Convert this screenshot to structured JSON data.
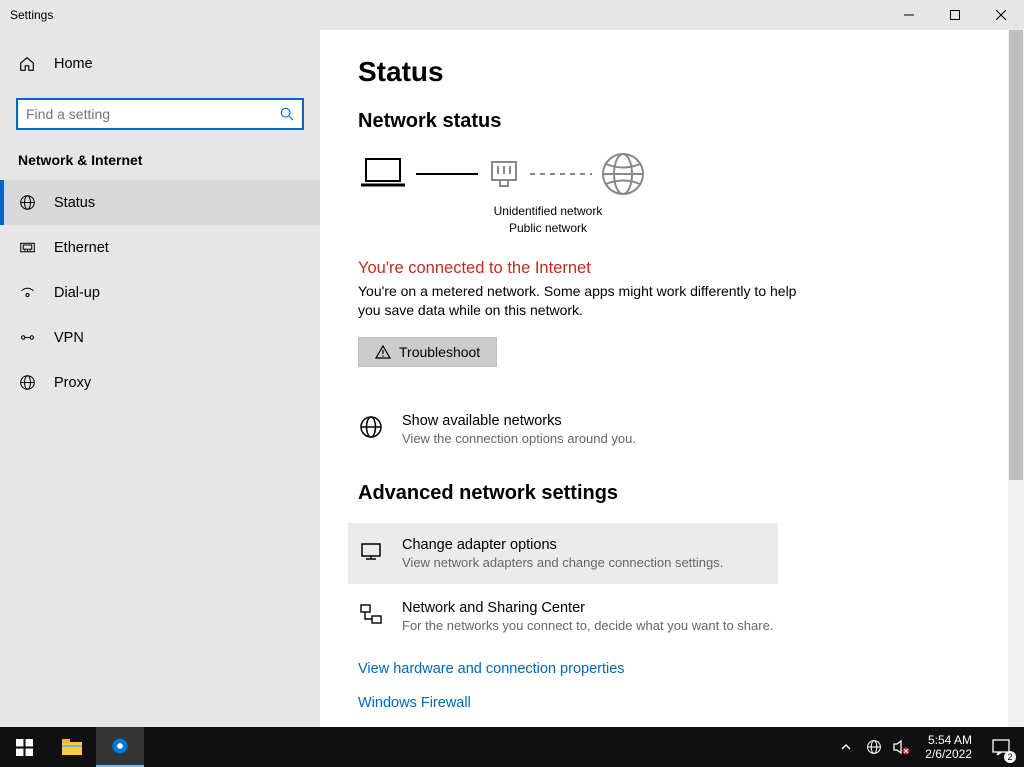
{
  "window": {
    "title": "Settings"
  },
  "sidebar": {
    "home": "Home",
    "search_placeholder": "Find a setting",
    "section": "Network & Internet",
    "items": [
      {
        "label": "Status",
        "icon": "globe-net-icon",
        "active": true
      },
      {
        "label": "Ethernet",
        "icon": "ethernet-icon",
        "active": false
      },
      {
        "label": "Dial-up",
        "icon": "dialup-icon",
        "active": false
      },
      {
        "label": "VPN",
        "icon": "vpn-icon",
        "active": false
      },
      {
        "label": "Proxy",
        "icon": "globe-icon",
        "active": false
      }
    ]
  },
  "main": {
    "title": "Status",
    "net_status_heading": "Network status",
    "diagram": {
      "label1": "Unidentified network",
      "label2": "Public network"
    },
    "status_title": "You're connected to the Internet",
    "status_desc": "You're on a metered network. Some apps might work differently to help you save data while on this network.",
    "troubleshoot": "Troubleshoot",
    "available": {
      "title": "Show available networks",
      "desc": "View the connection options around you."
    },
    "advanced_heading": "Advanced network settings",
    "adapter": {
      "title": "Change adapter options",
      "desc": "View network adapters and change connection settings."
    },
    "sharing": {
      "title": "Network and Sharing Center",
      "desc": "For the networks you connect to, decide what you want to share."
    },
    "link_hw": "View hardware and connection properties",
    "link_fw": "Windows Firewall"
  },
  "taskbar": {
    "time": "5:54 AM",
    "date": "2/6/2022",
    "notif_count": "2"
  }
}
